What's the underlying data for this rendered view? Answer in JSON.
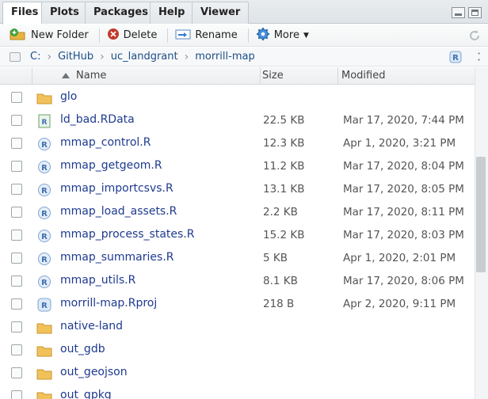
{
  "tabs": [
    {
      "label": "Files",
      "active": true
    },
    {
      "label": "Plots"
    },
    {
      "label": "Packages"
    },
    {
      "label": "Help"
    },
    {
      "label": "Viewer"
    }
  ],
  "toolbar": {
    "new_folder": "New Folder",
    "delete": "Delete",
    "rename": "Rename",
    "more": "More"
  },
  "breadcrumb": [
    "C:",
    "GitHub",
    "uc_landgrant",
    "morrill-map"
  ],
  "columns": {
    "name": "Name",
    "size": "Size",
    "modified": "Modified"
  },
  "files": [
    {
      "name": "glo",
      "type": "folder",
      "size": "",
      "modified": ""
    },
    {
      "name": "ld_bad.RData",
      "type": "rdata",
      "size": "22.5 KB",
      "modified": "Mar 17, 2020, 7:44 PM"
    },
    {
      "name": "mmap_control.R",
      "type": "r",
      "size": "12.3 KB",
      "modified": "Apr 1, 2020, 3:21 PM"
    },
    {
      "name": "mmap_getgeom.R",
      "type": "r",
      "size": "11.2 KB",
      "modified": "Mar 17, 2020, 8:04 PM"
    },
    {
      "name": "mmap_importcsvs.R",
      "type": "r",
      "size": "13.1 KB",
      "modified": "Mar 17, 2020, 8:05 PM"
    },
    {
      "name": "mmap_load_assets.R",
      "type": "r",
      "size": "2.2 KB",
      "modified": "Mar 17, 2020, 8:11 PM"
    },
    {
      "name": "mmap_process_states.R",
      "type": "r",
      "size": "15.2 KB",
      "modified": "Mar 17, 2020, 8:03 PM"
    },
    {
      "name": "mmap_summaries.R",
      "type": "r",
      "size": "5 KB",
      "modified": "Apr 1, 2020, 2:01 PM"
    },
    {
      "name": "mmap_utils.R",
      "type": "r",
      "size": "8.1 KB",
      "modified": "Mar 17, 2020, 8:06 PM"
    },
    {
      "name": "morrill-map.Rproj",
      "type": "rproj",
      "size": "218 B",
      "modified": "Apr 2, 2020, 9:11 PM"
    },
    {
      "name": "native-land",
      "type": "folder",
      "size": "",
      "modified": ""
    },
    {
      "name": "out_gdb",
      "type": "folder",
      "size": "",
      "modified": ""
    },
    {
      "name": "out_geojson",
      "type": "folder",
      "size": "",
      "modified": ""
    },
    {
      "name": "out_gpkg",
      "type": "folder",
      "size": "",
      "modified": ""
    }
  ],
  "colors": {
    "link": "#1e3a8f",
    "folder": "#e9b23f",
    "r_icon": "#3f6fb3",
    "delete": "#c0392b"
  }
}
